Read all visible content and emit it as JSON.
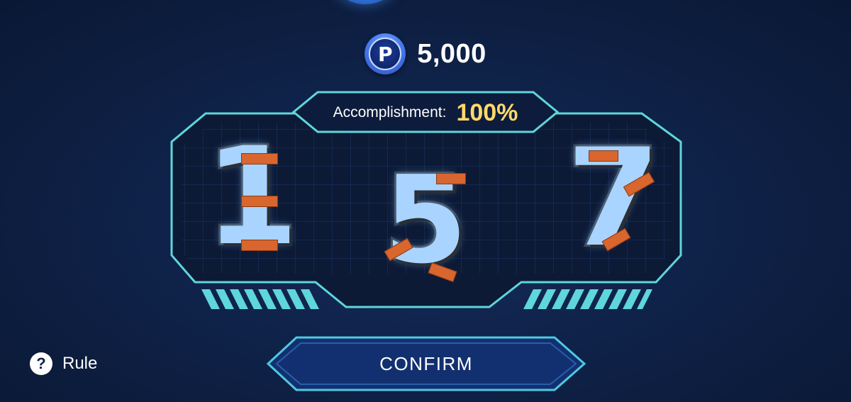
{
  "header": {
    "currency_icon": "P",
    "balance": "5,000"
  },
  "panel": {
    "accomplishment_label": "Accomplishment:",
    "accomplishment_value": "100%",
    "digits": [
      "1",
      "5",
      "7"
    ]
  },
  "footer": {
    "rule_icon": "?",
    "rule_label": "Rule",
    "confirm_label": "CONFIRM"
  },
  "colors": {
    "accent_cyan": "#5fd6d9",
    "accomplishment_yellow": "#ffd96a",
    "background": "#0f2249"
  },
  "icons": [
    "coin-p-icon",
    "question-icon"
  ]
}
